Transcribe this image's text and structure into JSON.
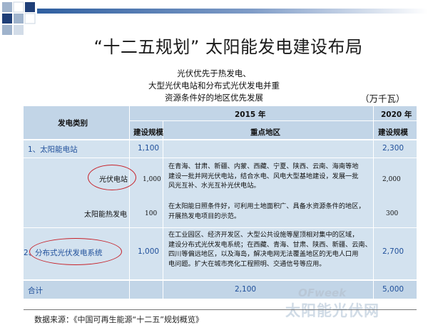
{
  "slide": {
    "title": "“十二五规划” 太阳能发电建设布局",
    "subtitle_lines": [
      "光伏优先于热发电、",
      "大型光伏电站和分布式光伏发电并重",
      "资源条件好的地区优先发展"
    ],
    "unit": "（万千瓦）"
  },
  "table": {
    "headers": {
      "category": "发电类别",
      "year_2015": "2015 年",
      "year_2020": "2020 年",
      "scale": "建设规模",
      "key_area": "重点地区",
      "scale_2020": "建设规模"
    },
    "rows": [
      {
        "label": "1、太阳能电站",
        "scale_2015": "1,100",
        "desc": "",
        "scale_2020": "2,300"
      },
      {
        "label": "光伏电站",
        "scale_2015": "1,000",
        "desc": [
          "在青海、甘肃、新疆、内蒙、西藏、宁夏、陕西、云南、海南等地",
          "建设一批并网光伏电站，结合水电、风电大型基地建设，发展一批",
          "风光互补、水光互补光伏电站。"
        ],
        "scale_2020": "2,000"
      },
      {
        "label": "太阳能热发电",
        "scale_2015": "100",
        "desc": [
          "在太阳能日照条件好，可利用土地面积广、具备水资源条件的地区，",
          "开展热发电项目的示范。"
        ],
        "scale_2020": "300"
      },
      {
        "label_prefix": "2、",
        "label": "分布式光伏发电系统",
        "scale_2015": "1,000",
        "desc": [
          "在工业园区、经济开发区、大型公共设施等屋顶相对集中的区域，",
          "建设分布式光伏发电系统；在西藏、青海、甘肃、陕西、新疆、云南、",
          "四川等偏远地区，以及海岛，解决电网无法覆盖地区的无电人口用",
          "电问题。扩大在城市亮化工程照明、交通信号等应用。"
        ],
        "scale_2020": "2,700"
      },
      {
        "label": "合计",
        "scale_2015": "2,100",
        "desc": "",
        "scale_2020": "5,000"
      }
    ]
  },
  "source": "数据来源：《中国可再生能源“十二五”规划概览》",
  "watermark": {
    "brand": "OFweek",
    "site": "太阳能光伏网"
  },
  "colors": {
    "table_bg": "#d3e2ef",
    "band": "#c2d5e7",
    "highlight_oval": "#c7222a",
    "label_blue": "#1f4f9a",
    "deco_blue": "#2f5fa0"
  }
}
